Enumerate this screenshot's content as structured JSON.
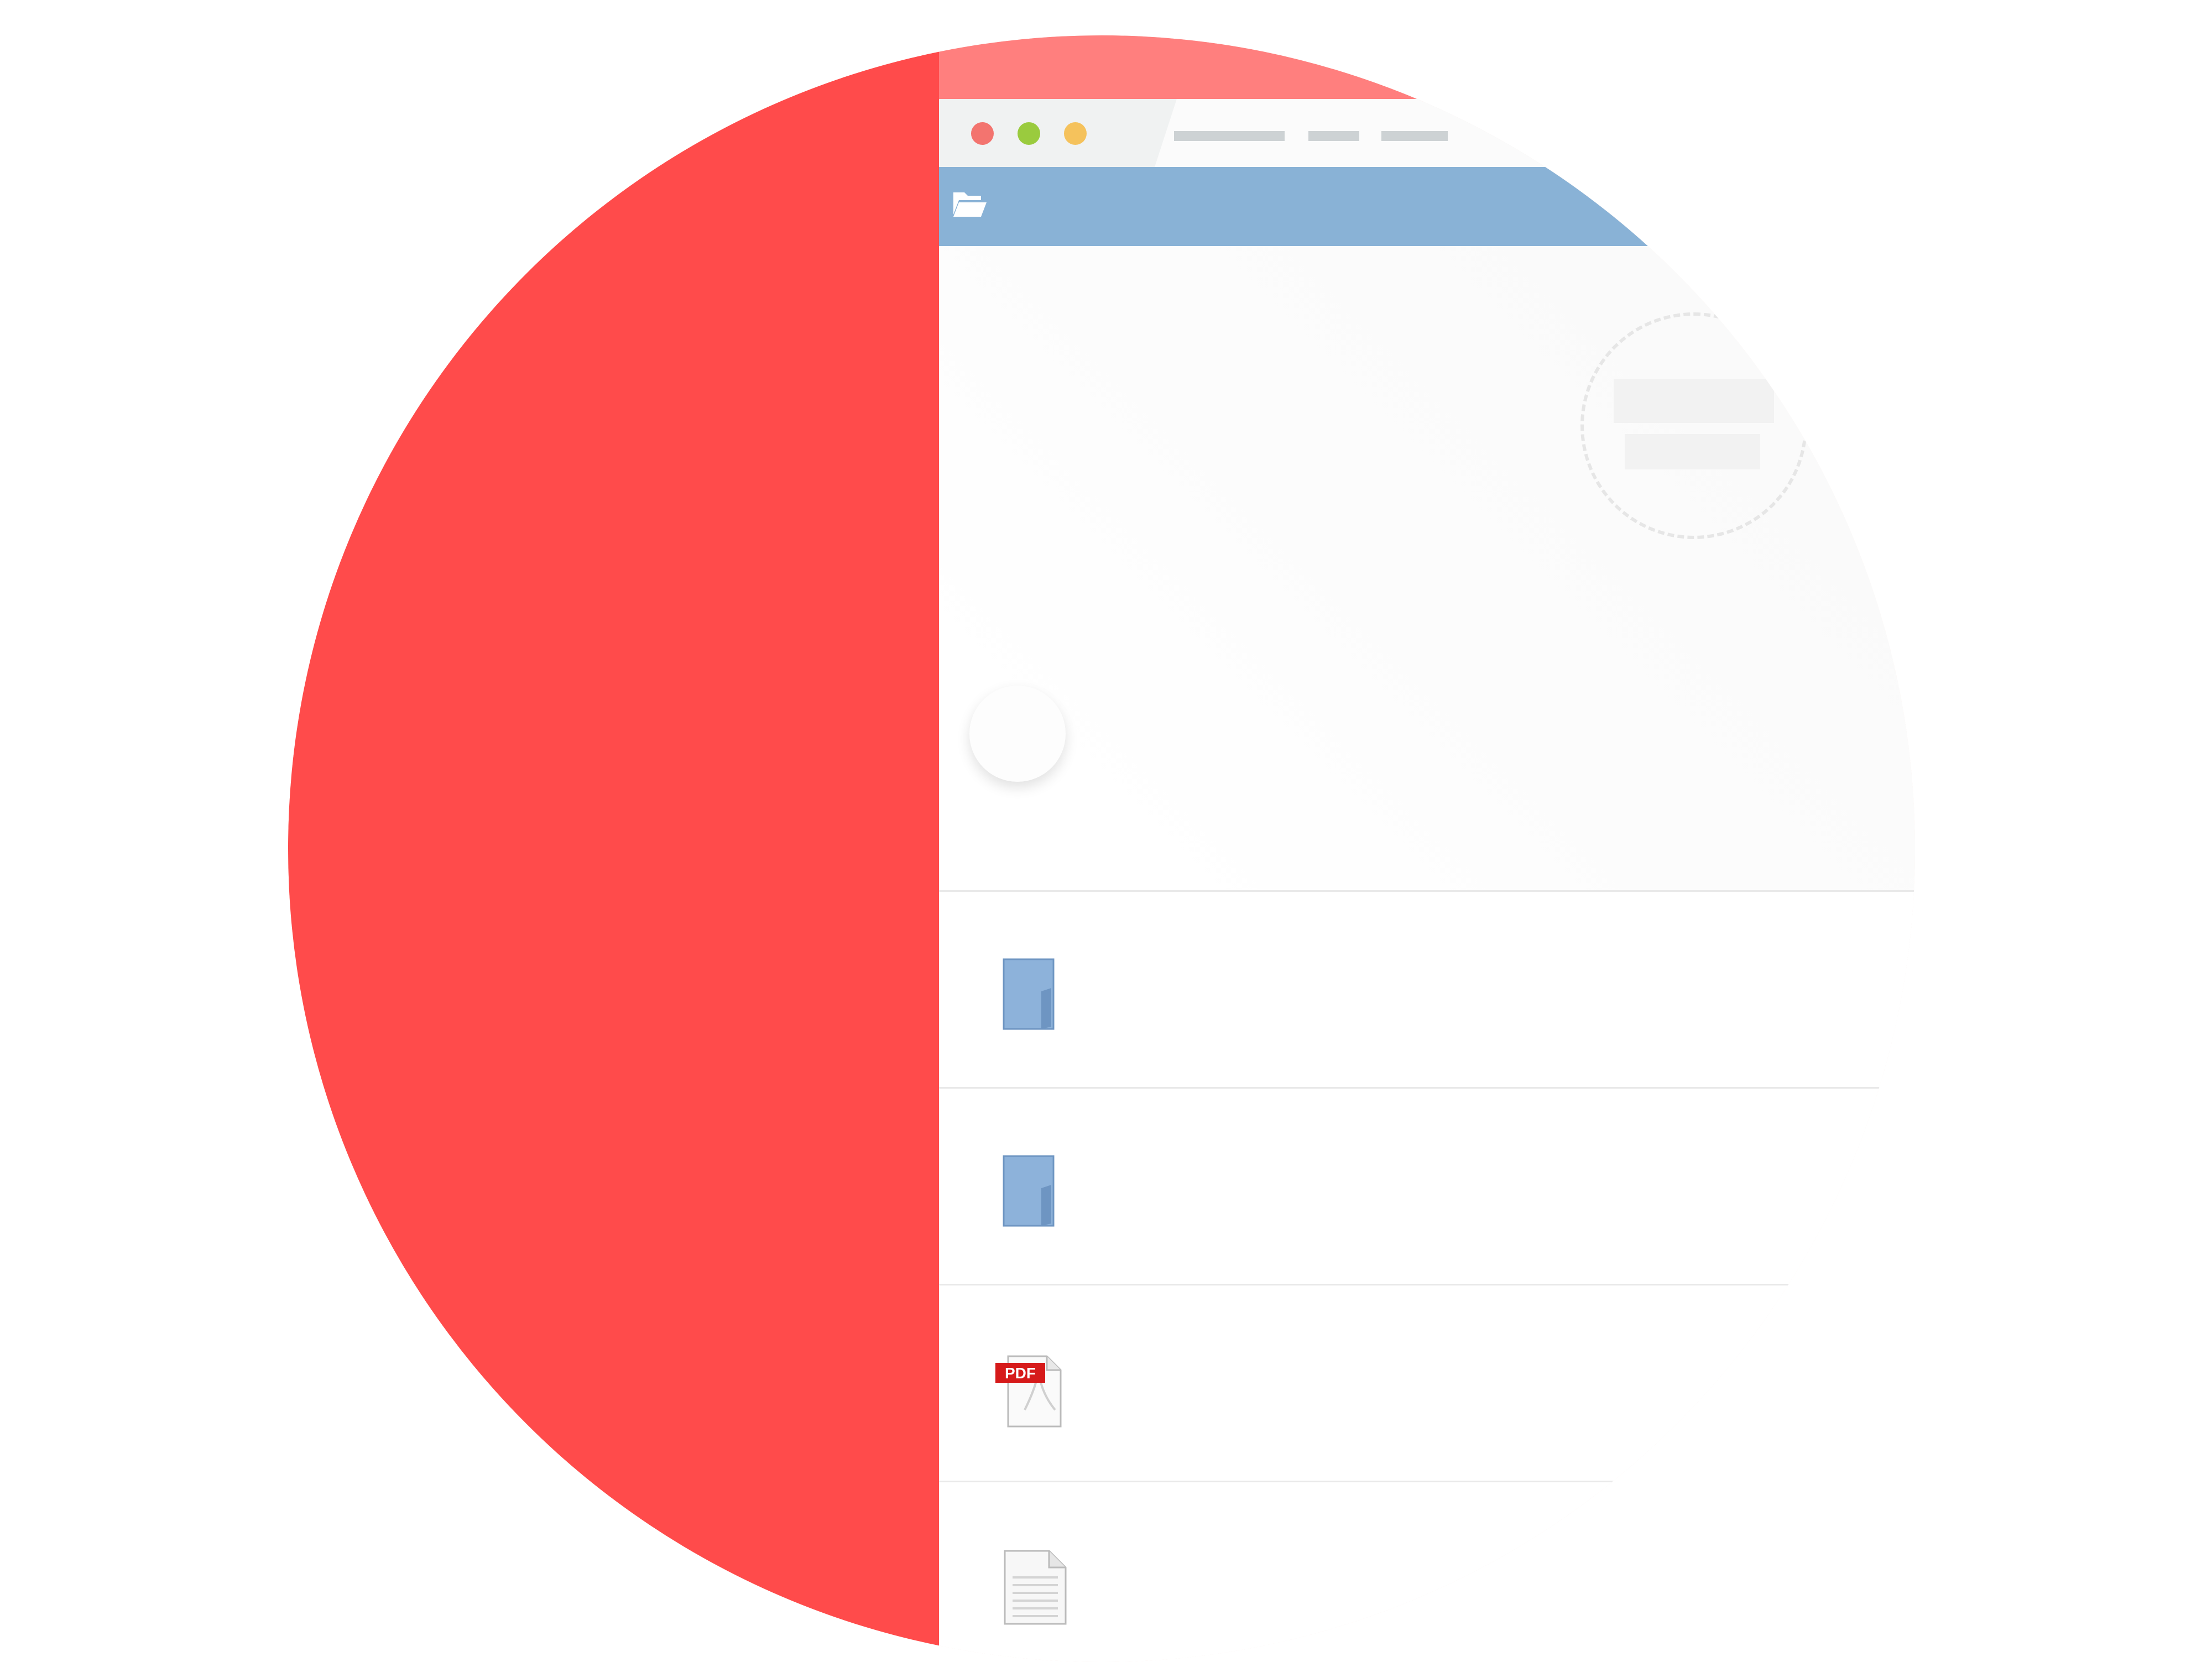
{
  "window": {
    "traffic_lights": [
      "close",
      "minimize",
      "zoom"
    ]
  },
  "toolbar": {
    "icon": "folder-open-icon"
  },
  "files": [
    {
      "name": "",
      "icon": "folder-icon"
    },
    {
      "name": "",
      "icon": "folder-icon"
    },
    {
      "name": "",
      "icon": "pdf-file-icon",
      "badge": "PDF"
    },
    {
      "name": "",
      "icon": "text-file-icon"
    }
  ],
  "colors": {
    "brand_red": "#ff4b4b",
    "toolbar_blue": "#89b2d6",
    "folder_blue": "#8db2da"
  }
}
